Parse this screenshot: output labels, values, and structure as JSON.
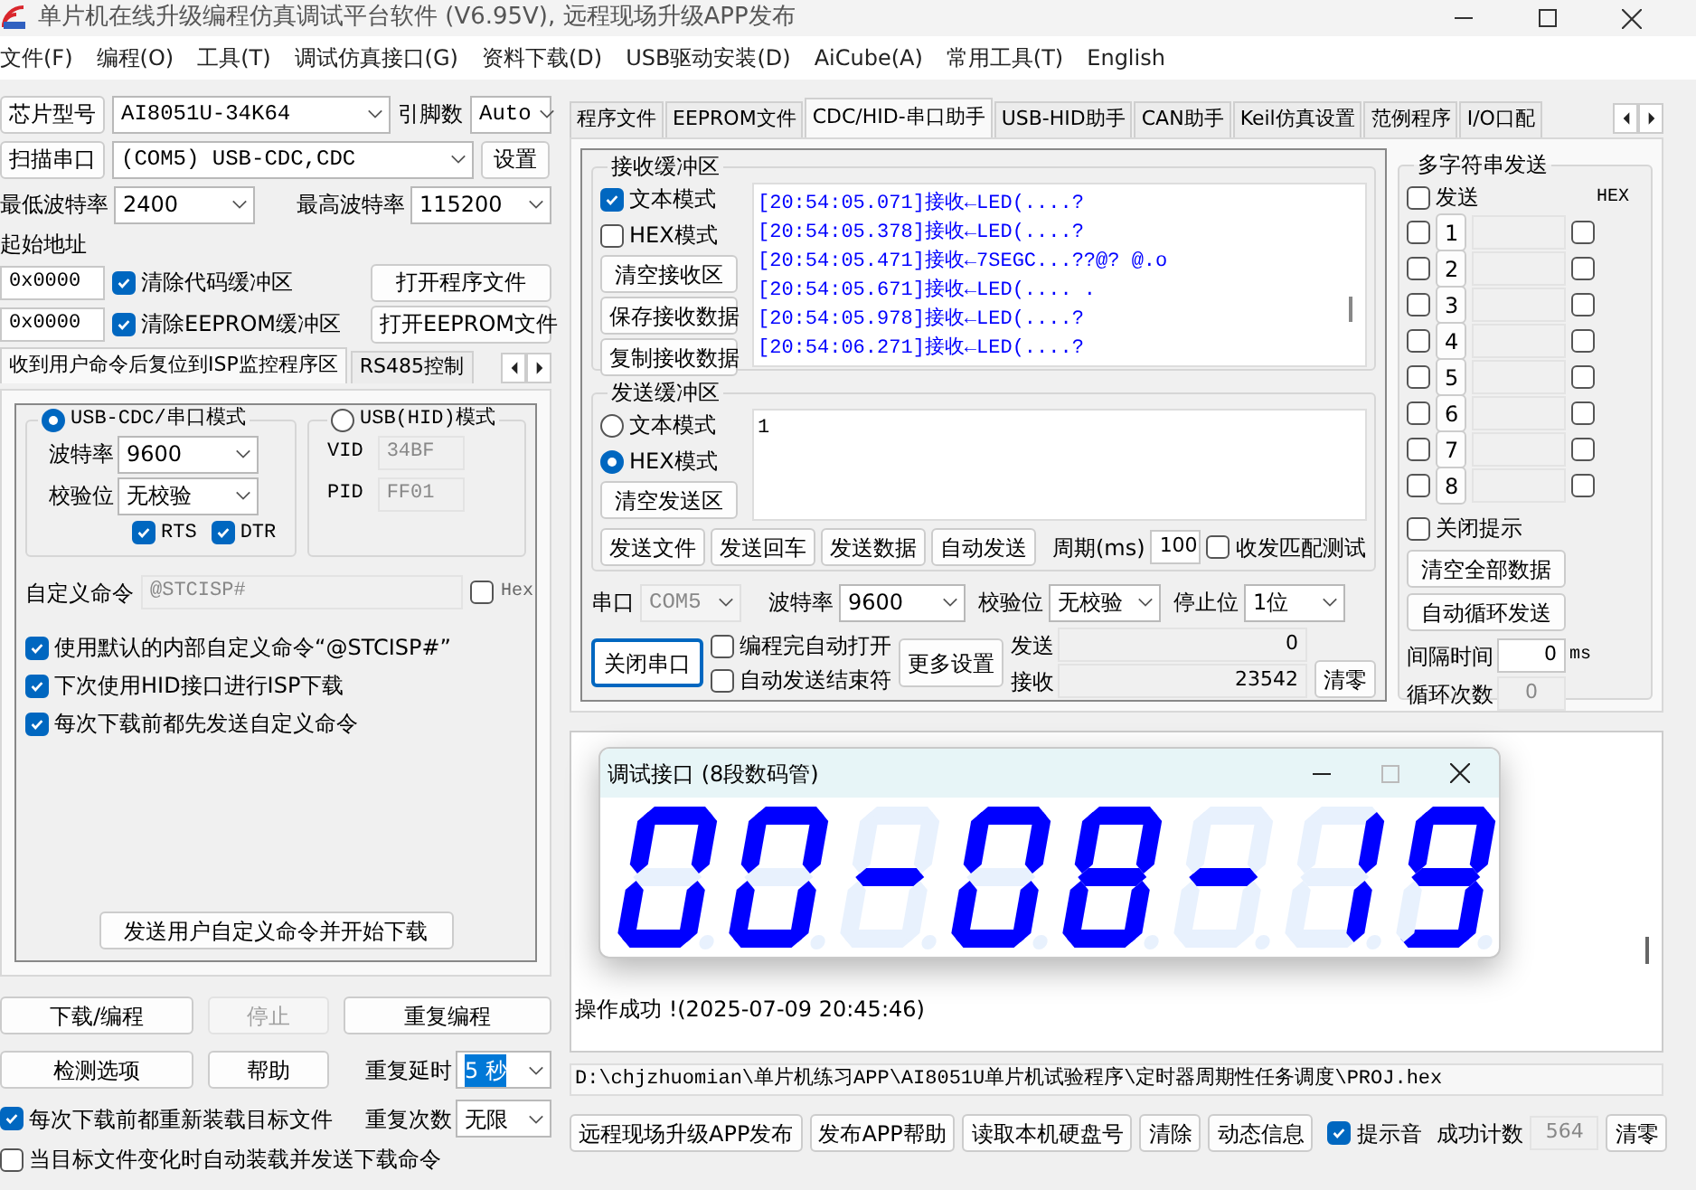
{
  "window": {
    "title": "单片机在线升级编程仿真调试平台软件 (V6.95V), 远程现场升级APP发布"
  },
  "menu": [
    "文件(F)",
    "编程(O)",
    "工具(T)",
    "调试仿真接口(G)",
    "资料下载(D)",
    "USB驱动安装(D)",
    "AiCube(A)",
    "常用工具(T)",
    "English"
  ],
  "chip": {
    "button": "芯片型号",
    "model": "AI8051U-34K64",
    "pins_label": "引脚数",
    "pins": "Auto"
  },
  "port": {
    "button": "扫描串口",
    "value": "(COM5) USB-CDC,CDC",
    "settings_button": "设置"
  },
  "baud": {
    "min_label": "最低波特率",
    "min": "2400",
    "max_label": "最高波特率",
    "max": "115200"
  },
  "address": {
    "label": "起始地址",
    "rows": [
      {
        "value": "0x0000",
        "checkbox": "清除代码缓冲区",
        "checked": true,
        "button": "打开程序文件"
      },
      {
        "value": "0x0000",
        "checkbox": "清除EEPROM缓冲区",
        "checked": true,
        "button": "打开EEPROM文件"
      }
    ]
  },
  "left_tabs": [
    {
      "label": "收到用户命令后复位到ISP监控程序区",
      "selected": true
    },
    {
      "label": "RS485控制",
      "selected": false
    }
  ],
  "isp": {
    "cdc": {
      "label": "USB-CDC/串口模式",
      "selected": true,
      "baud_label": "波特率",
      "baud": "9600",
      "parity_label": "校验位",
      "parity": "无校验",
      "flags": [
        {
          "label": "RTS",
          "checked": true
        },
        {
          "label": "DTR",
          "checked": true
        }
      ]
    },
    "hid": {
      "label": "USB(HID)模式",
      "selected": false,
      "fields": [
        {
          "label": "VID",
          "value": "34BF"
        },
        {
          "label": "PID",
          "value": "FF01"
        }
      ]
    },
    "custom_command": {
      "label": "自定义命令",
      "value": "@STCISP#",
      "hex_label": "Hex",
      "hex_checked": false
    },
    "options": [
      {
        "label": "使用默认的内部自定义命令“@STCISP#”",
        "checked": true
      },
      {
        "label": "下次使用HID接口进行ISP下载",
        "checked": true
      },
      {
        "label": "每次下载前都先发送自定义命令",
        "checked": true
      }
    ],
    "send_button": "发送用户自定义命令并开始下载"
  },
  "actions": {
    "buttons": [
      {
        "label": "下载/编程",
        "disabled": false
      },
      {
        "label": "停止",
        "disabled": true
      },
      {
        "label": "重复编程",
        "disabled": false
      },
      {
        "label": "检测选项",
        "disabled": false
      },
      {
        "label": "帮助",
        "disabled": false
      }
    ],
    "delay_label": "重复延时",
    "delay": "5 秒",
    "delay_highlighted": true,
    "count_label": "重复次数",
    "count": "无限",
    "options": [
      {
        "label": "每次下载前都重新装载目标文件",
        "checked": true
      },
      {
        "label": "当目标文件变化时自动装载并发送下载命令",
        "checked": false
      }
    ]
  },
  "tabs": [
    {
      "label": "程序文件",
      "selected": false
    },
    {
      "label": "EEPROM文件",
      "selected": false
    },
    {
      "label": "CDC/HID-串口助手",
      "selected": true
    },
    {
      "label": "USB-HID助手",
      "selected": false
    },
    {
      "label": "CAN助手",
      "selected": false
    },
    {
      "label": "Keil仿真设置",
      "selected": false
    },
    {
      "label": "范例程序",
      "selected": false
    },
    {
      "label": "I/O口配",
      "selected": false
    }
  ],
  "receive": {
    "title": "接收缓冲区",
    "modes": [
      {
        "label": "文本模式",
        "checked": true
      },
      {
        "label": "HEX模式",
        "checked": false
      }
    ],
    "buttons": [
      "清空接收区",
      "保存接收数据",
      "复制接收数据"
    ],
    "lines": [
      "[20:54:05.071]接收←LED(....?",
      "[20:54:05.378]接收←LED(....?",
      "[20:54:05.471]接收←7SEGC...??@? @.o",
      "[20:54:05.671]接收←LED(.... .",
      "[20:54:05.978]接收←LED(....?",
      "[20:54:06.271]接收←LED(....?"
    ]
  },
  "send": {
    "title": "发送缓冲区",
    "modes": [
      {
        "label": "文本模式",
        "selected": false
      },
      {
        "label": "HEX模式",
        "selected": true
      }
    ],
    "clear_button": "清空发送区",
    "value": "1",
    "buttons": [
      "发送文件",
      "发送回车",
      "发送数据",
      "自动发送"
    ],
    "period_label": "周期(ms)",
    "period": "100",
    "match_label": "收发匹配测试",
    "match_checked": false
  },
  "serial": {
    "port_label": "串口",
    "port": "COM5",
    "baud_label": "波特率",
    "baud": "9600",
    "parity_label": "校验位",
    "parity": "无校验",
    "stop_label": "停止位",
    "stop": "1位",
    "close_button": "关闭串口",
    "options": [
      {
        "label": "编程完自动打开",
        "checked": false
      },
      {
        "label": "自动发送结束符",
        "checked": false
      }
    ],
    "more_button": "更多设置",
    "counters": [
      {
        "label": "发送",
        "value": "0"
      },
      {
        "label": "接收",
        "value": "23542"
      }
    ],
    "clear_button": "清零"
  },
  "multi": {
    "title": "多字符串发送",
    "send_label": "发送",
    "send_checked": false,
    "hex_label": "HEX",
    "rows": [
      {
        "index": "1",
        "checked": false,
        "hex": false
      },
      {
        "index": "2",
        "checked": false,
        "hex": false
      },
      {
        "index": "3",
        "checked": false,
        "hex": false
      },
      {
        "index": "4",
        "checked": false,
        "hex": false
      },
      {
        "index": "5",
        "checked": false,
        "hex": false
      },
      {
        "index": "6",
        "checked": false,
        "hex": false
      },
      {
        "index": "7",
        "checked": false,
        "hex": false
      },
      {
        "index": "8",
        "checked": false,
        "hex": false
      }
    ],
    "close_tip": {
      "label": "关闭提示",
      "checked": false
    },
    "buttons": [
      "清空全部数据",
      "自动循环发送"
    ],
    "interval_label": "间隔时间",
    "interval": "0",
    "interval_unit": "ms",
    "loop_label": "循环次数",
    "loop": "0"
  },
  "log": {
    "lines": [
      "操作成功 !(2025-07-09 20:45:46)"
    ]
  },
  "path": "D:\\chjzhuomian\\单片机练习APP\\AI8051U单片机试验程序\\定时器周期性任务调度\\PROJ.hex",
  "bottom": {
    "buttons": [
      "远程现场升级APP发布",
      "发布APP帮助",
      "读取本机硬盘号",
      "清除",
      "动态信息"
    ],
    "sound": {
      "label": "提示音",
      "checked": true
    },
    "count_label": "成功计数",
    "count": "564",
    "reset_button": "清零"
  },
  "display": {
    "title": "调试接口 (8段数码管)",
    "digits": [
      {
        "a": true,
        "b": true,
        "c": true,
        "d": true,
        "e": true,
        "f": true,
        "g": false
      },
      {
        "a": true,
        "b": true,
        "c": true,
        "d": true,
        "e": true,
        "f": true,
        "g": false
      },
      {
        "a": false,
        "b": false,
        "c": false,
        "d": false,
        "e": false,
        "f": false,
        "g": true
      },
      {
        "a": true,
        "b": true,
        "c": true,
        "d": true,
        "e": true,
        "f": true,
        "g": false
      },
      {
        "a": true,
        "b": true,
        "c": true,
        "d": true,
        "e": true,
        "f": true,
        "g": true
      },
      {
        "a": false,
        "b": false,
        "c": false,
        "d": false,
        "e": false,
        "f": false,
        "g": true
      },
      {
        "a": false,
        "b": true,
        "c": true,
        "d": false,
        "e": false,
        "f": false,
        "g": false
      },
      {
        "a": true,
        "b": true,
        "c": true,
        "d": true,
        "e": false,
        "f": true,
        "g": true
      }
    ]
  }
}
